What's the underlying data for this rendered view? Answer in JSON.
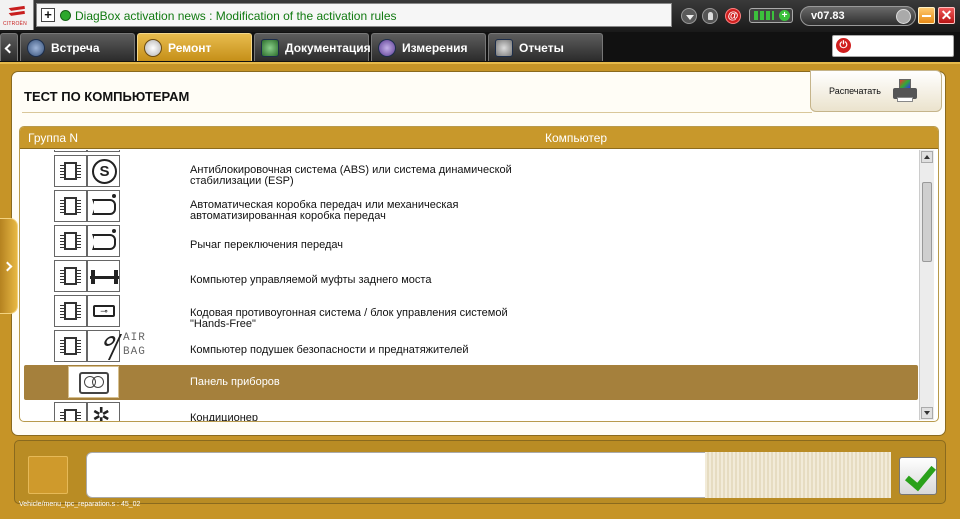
{
  "brand": {
    "logo_text": "CITROËN"
  },
  "news": {
    "text": "DiagBox activation news : Modification of the activation rules"
  },
  "toolbar": {
    "version": "v07.83",
    "mail_icon": "@",
    "battery_plus": "+",
    "close_glyph": "✕"
  },
  "tabs": [
    {
      "label": "Встреча",
      "icon": "meeting-icon"
    },
    {
      "label": "Ремонт",
      "icon": "magnifier-icon",
      "active": true
    },
    {
      "label": "Документация",
      "icon": "book-icon"
    },
    {
      "label": "Измерения",
      "icon": "waveform-icon"
    },
    {
      "label": "Отчеты",
      "icon": "report-icon"
    }
  ],
  "search": {
    "value": "",
    "power_glyph": "⏻"
  },
  "page": {
    "title": "ТЕСТ ПО КОМПЬЮТЕРАМ",
    "print_label": "Распечатать"
  },
  "table": {
    "headers": {
      "group": "Группа N",
      "computer": "Компьютер"
    },
    "rows": [
      {
        "line1": "Антиблокировочная система (ABS) или система динамической",
        "line2": "стабилизации (ESP)",
        "icon": "abs-icon",
        "icon_text": "S"
      },
      {
        "line1": "Автоматическая коробка передач или механическая",
        "line2": "автоматизированная коробка передач",
        "icon": "gearbox-icon"
      },
      {
        "line1": "Рычаг переключения передач",
        "line2": "",
        "icon": "gear-lever-icon"
      },
      {
        "line1": "Компьютер управляемой муфты заднего моста",
        "line2": "",
        "icon": "axle-icon"
      },
      {
        "line1": "Кодовая противоугонная система / блок управления системой",
        "line2": "\"Hands-Free\"",
        "icon": "key-icon",
        "icon_text": "⊸"
      },
      {
        "line1": "Компьютер подушек безопасности и преднатяжителей",
        "line2": "",
        "icon": "seatbelt-icon",
        "icon_text_1": "AIR",
        "icon_text_2": "BAG"
      },
      {
        "line1": "Панель приборов",
        "line2": "",
        "icon": "dashboard-icon",
        "selected": true
      },
      {
        "line1": "Кондиционер",
        "line2": "",
        "icon": "fan-icon",
        "icon_text": "✲"
      }
    ]
  },
  "footer": {
    "path": "Vehicle/menu_tpc_reparation.s : 45_02"
  }
}
